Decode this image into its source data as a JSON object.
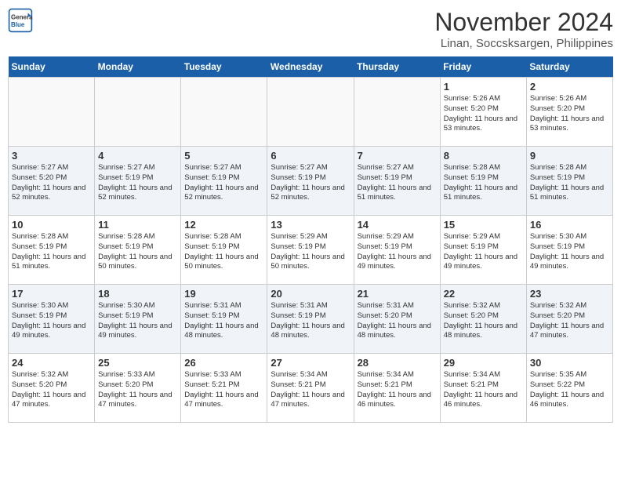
{
  "header": {
    "logo_line1": "General",
    "logo_line2": "Blue",
    "title": "November 2024",
    "subtitle": "Linan, Soccsksargen, Philippines"
  },
  "days": [
    "Sunday",
    "Monday",
    "Tuesday",
    "Wednesday",
    "Thursday",
    "Friday",
    "Saturday"
  ],
  "weeks": [
    [
      {
        "day": "",
        "info": ""
      },
      {
        "day": "",
        "info": ""
      },
      {
        "day": "",
        "info": ""
      },
      {
        "day": "",
        "info": ""
      },
      {
        "day": "",
        "info": ""
      },
      {
        "day": "1",
        "info": "Sunrise: 5:26 AM\nSunset: 5:20 PM\nDaylight: 11 hours\nand 53 minutes."
      },
      {
        "day": "2",
        "info": "Sunrise: 5:26 AM\nSunset: 5:20 PM\nDaylight: 11 hours\nand 53 minutes."
      }
    ],
    [
      {
        "day": "3",
        "info": "Sunrise: 5:27 AM\nSunset: 5:20 PM\nDaylight: 11 hours\nand 52 minutes."
      },
      {
        "day": "4",
        "info": "Sunrise: 5:27 AM\nSunset: 5:19 PM\nDaylight: 11 hours\nand 52 minutes."
      },
      {
        "day": "5",
        "info": "Sunrise: 5:27 AM\nSunset: 5:19 PM\nDaylight: 11 hours\nand 52 minutes."
      },
      {
        "day": "6",
        "info": "Sunrise: 5:27 AM\nSunset: 5:19 PM\nDaylight: 11 hours\nand 52 minutes."
      },
      {
        "day": "7",
        "info": "Sunrise: 5:27 AM\nSunset: 5:19 PM\nDaylight: 11 hours\nand 51 minutes."
      },
      {
        "day": "8",
        "info": "Sunrise: 5:28 AM\nSunset: 5:19 PM\nDaylight: 11 hours\nand 51 minutes."
      },
      {
        "day": "9",
        "info": "Sunrise: 5:28 AM\nSunset: 5:19 PM\nDaylight: 11 hours\nand 51 minutes."
      }
    ],
    [
      {
        "day": "10",
        "info": "Sunrise: 5:28 AM\nSunset: 5:19 PM\nDaylight: 11 hours\nand 51 minutes."
      },
      {
        "day": "11",
        "info": "Sunrise: 5:28 AM\nSunset: 5:19 PM\nDaylight: 11 hours\nand 50 minutes."
      },
      {
        "day": "12",
        "info": "Sunrise: 5:28 AM\nSunset: 5:19 PM\nDaylight: 11 hours\nand 50 minutes."
      },
      {
        "day": "13",
        "info": "Sunrise: 5:29 AM\nSunset: 5:19 PM\nDaylight: 11 hours\nand 50 minutes."
      },
      {
        "day": "14",
        "info": "Sunrise: 5:29 AM\nSunset: 5:19 PM\nDaylight: 11 hours\nand 49 minutes."
      },
      {
        "day": "15",
        "info": "Sunrise: 5:29 AM\nSunset: 5:19 PM\nDaylight: 11 hours\nand 49 minutes."
      },
      {
        "day": "16",
        "info": "Sunrise: 5:30 AM\nSunset: 5:19 PM\nDaylight: 11 hours\nand 49 minutes."
      }
    ],
    [
      {
        "day": "17",
        "info": "Sunrise: 5:30 AM\nSunset: 5:19 PM\nDaylight: 11 hours\nand 49 minutes."
      },
      {
        "day": "18",
        "info": "Sunrise: 5:30 AM\nSunset: 5:19 PM\nDaylight: 11 hours\nand 49 minutes."
      },
      {
        "day": "19",
        "info": "Sunrise: 5:31 AM\nSunset: 5:19 PM\nDaylight: 11 hours\nand 48 minutes."
      },
      {
        "day": "20",
        "info": "Sunrise: 5:31 AM\nSunset: 5:19 PM\nDaylight: 11 hours\nand 48 minutes."
      },
      {
        "day": "21",
        "info": "Sunrise: 5:31 AM\nSunset: 5:20 PM\nDaylight: 11 hours\nand 48 minutes."
      },
      {
        "day": "22",
        "info": "Sunrise: 5:32 AM\nSunset: 5:20 PM\nDaylight: 11 hours\nand 48 minutes."
      },
      {
        "day": "23",
        "info": "Sunrise: 5:32 AM\nSunset: 5:20 PM\nDaylight: 11 hours\nand 47 minutes."
      }
    ],
    [
      {
        "day": "24",
        "info": "Sunrise: 5:32 AM\nSunset: 5:20 PM\nDaylight: 11 hours\nand 47 minutes."
      },
      {
        "day": "25",
        "info": "Sunrise: 5:33 AM\nSunset: 5:20 PM\nDaylight: 11 hours\nand 47 minutes."
      },
      {
        "day": "26",
        "info": "Sunrise: 5:33 AM\nSunset: 5:21 PM\nDaylight: 11 hours\nand 47 minutes."
      },
      {
        "day": "27",
        "info": "Sunrise: 5:34 AM\nSunset: 5:21 PM\nDaylight: 11 hours\nand 47 minutes."
      },
      {
        "day": "28",
        "info": "Sunrise: 5:34 AM\nSunset: 5:21 PM\nDaylight: 11 hours\nand 46 minutes."
      },
      {
        "day": "29",
        "info": "Sunrise: 5:34 AM\nSunset: 5:21 PM\nDaylight: 11 hours\nand 46 minutes."
      },
      {
        "day": "30",
        "info": "Sunrise: 5:35 AM\nSunset: 5:22 PM\nDaylight: 11 hours\nand 46 minutes."
      }
    ]
  ]
}
